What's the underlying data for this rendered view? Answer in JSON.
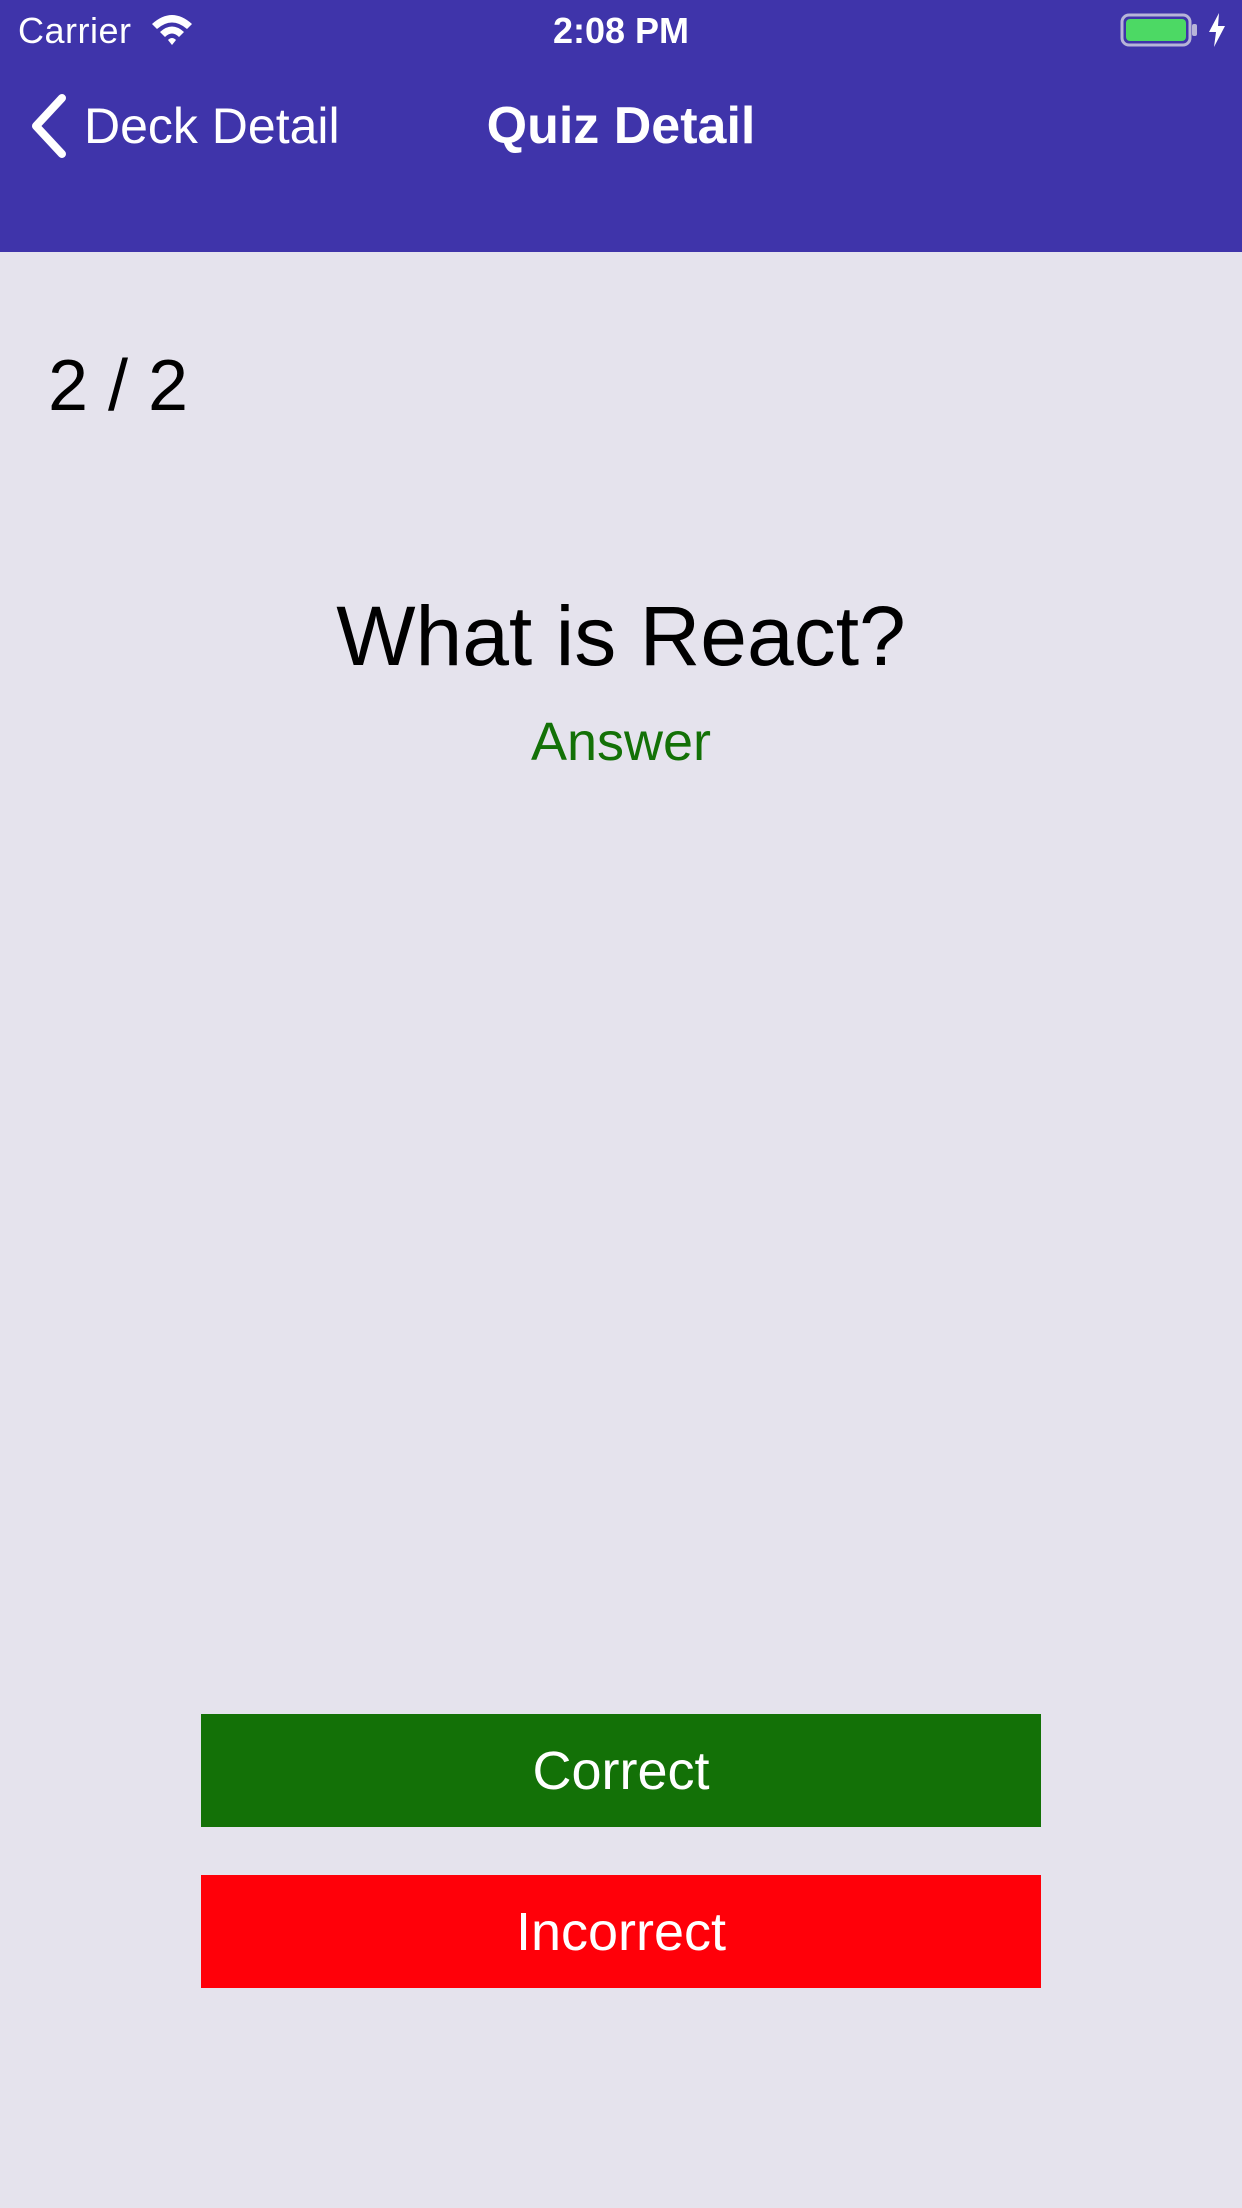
{
  "status_bar": {
    "carrier": "Carrier",
    "time": "2:08 PM",
    "wifi_icon": "wifi-icon",
    "battery_icon": "battery-icon",
    "charging_icon": "charging-bolt-icon",
    "battery_level": 1.0
  },
  "nav": {
    "back_icon": "chevron-left-icon",
    "back_label": "Deck Detail",
    "title": "Quiz Detail"
  },
  "quiz": {
    "progress": "2 / 2",
    "question": "What is React?",
    "toggle_label": "Answer",
    "correct_label": "Correct",
    "incorrect_label": "Incorrect"
  },
  "colors": {
    "header": "#3f34aa",
    "background": "#e5e3ed",
    "answer_text": "#137107",
    "correct_button": "#137107",
    "incorrect_button": "#ff0009",
    "battery_fill": "#4cd964"
  }
}
